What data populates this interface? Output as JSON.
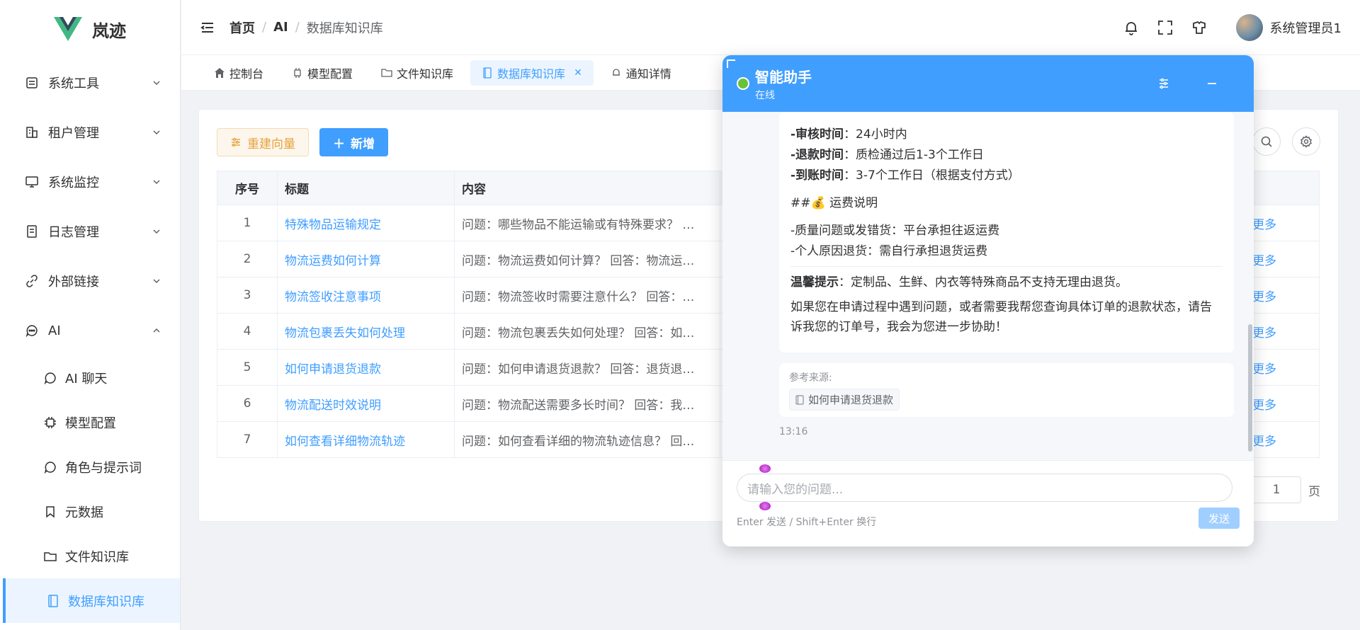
{
  "app": {
    "name": "岚迹"
  },
  "sidebar": {
    "items": [
      {
        "label": "系统工具",
        "icon": "toolbox-icon"
      },
      {
        "label": "租户管理",
        "icon": "building-icon"
      },
      {
        "label": "系统监控",
        "icon": "monitor-icon"
      },
      {
        "label": "日志管理",
        "icon": "document-icon"
      },
      {
        "label": "外部链接",
        "icon": "link-icon"
      },
      {
        "label": "AI",
        "icon": "chat-icon"
      }
    ],
    "ai_children": [
      {
        "label": "AI 聊天",
        "icon": "chat-icon"
      },
      {
        "label": "模型配置",
        "icon": "chip-icon"
      },
      {
        "label": "角色与提示词",
        "icon": "chat-icon"
      },
      {
        "label": "元数据",
        "icon": "bookmark-icon"
      },
      {
        "label": "文件知识库",
        "icon": "folder-icon"
      },
      {
        "label": "数据库知识库",
        "icon": "book-icon"
      }
    ]
  },
  "header": {
    "breadcrumb": [
      "首页",
      "AI",
      "数据库知识库"
    ],
    "user_name": "系统管理员1"
  },
  "tabs": [
    {
      "label": "控制台",
      "icon": "home-icon"
    },
    {
      "label": "模型配置",
      "icon": "chip-icon"
    },
    {
      "label": "文件知识库",
      "icon": "folder-icon"
    },
    {
      "label": "数据库知识库",
      "icon": "book-icon",
      "active": true
    },
    {
      "label": "通知详情",
      "icon": "bell-icon"
    }
  ],
  "toolbar": {
    "rebuild_label": "重建向量",
    "add_label": "新增"
  },
  "table": {
    "headers": [
      "序号",
      "标题",
      "内容"
    ],
    "more_label": "更多",
    "rows": [
      {
        "idx": "1",
        "title": "特殊物品运输规定",
        "content": "问题：哪些物品不能运输或有特殊要求？ …"
      },
      {
        "idx": "2",
        "title": "物流运费如何计算",
        "content": "问题：物流运费如何计算？ 回答：物流运…"
      },
      {
        "idx": "3",
        "title": "物流签收注意事项",
        "content": "问题：物流签收时需要注意什么？ 回答：…"
      },
      {
        "idx": "4",
        "title": "物流包裹丢失如何处理",
        "content": "问题：物流包裹丢失如何处理？ 回答：如…"
      },
      {
        "idx": "5",
        "title": "如何申请退货退款",
        "content": "问题：如何申请退货退款？ 回答：退货退…"
      },
      {
        "idx": "6",
        "title": "物流配送时效说明",
        "content": "问题：物流配送需要多长时间？ 回答：我…"
      },
      {
        "idx": "7",
        "title": "如何查看详细物流轨迹",
        "content": "问题：如何查看详细的物流轨迹信息？ 回…"
      }
    ]
  },
  "pager": {
    "page": "1",
    "suffix": "页"
  },
  "chat": {
    "title": "智能助手",
    "status": "在线",
    "lines": [
      {
        "key": "-审核时间",
        "value": "：24小时内"
      },
      {
        "key": "-退款时间",
        "value": "：质检通过后1-3个工作日"
      },
      {
        "key": "-到账时间",
        "value": "：3-7个工作日（根据支付方式）"
      }
    ],
    "heading_prefix": "##",
    "heading_emoji": "💰",
    "heading": "运费说明",
    "freight": [
      "-质量问题或发错货：平台承担往返运费",
      "-个人原因退货：需自行承担退货运费"
    ],
    "tip_key": "温馨提示",
    "tip_value": "：定制品、生鲜、内衣等特殊商品不支持无理由退货。",
    "closing": "如果您在申请过程中遇到问题，或者需要我帮您查询具体订单的退款状态，请告诉我您的订单号，我会为您进一步协助！",
    "ref_label": "参考来源:",
    "ref_item": "如何申请退货退款",
    "time": "13:16",
    "input_placeholder": "请输入您的问题...",
    "hint": "Enter 发送 / Shift+Enter 换行",
    "send_label": "发送"
  }
}
